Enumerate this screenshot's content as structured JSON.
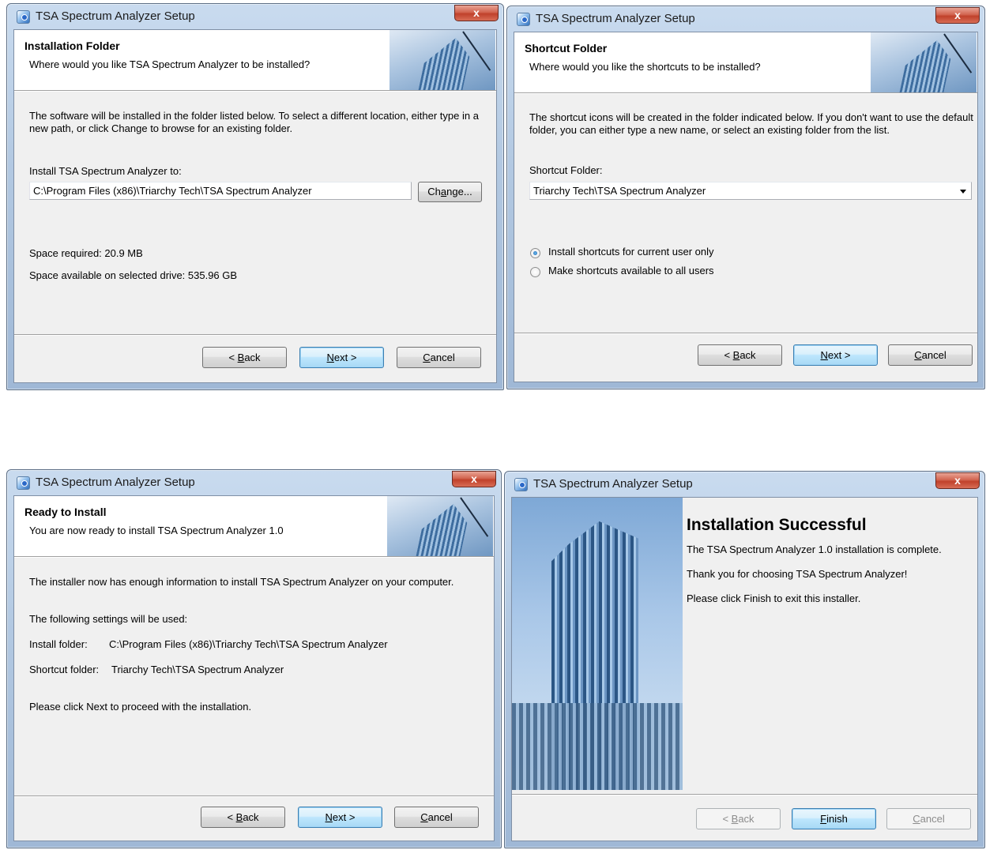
{
  "window_title": "TSA Spectrum Analyzer Setup",
  "close_label": "x",
  "buttons": {
    "back_pre": "< ",
    "back_key": "B",
    "back_post": "ack",
    "next_key": "N",
    "next_post": "ext >",
    "cancel_key": "C",
    "cancel_post": "ancel",
    "finish_key": "F",
    "finish_post": "inish"
  },
  "install_folder": {
    "heading": "Installation Folder",
    "subheading": "Where would you like TSA Spectrum Analyzer to be installed?",
    "description_line1": "The software will be installed in the folder listed below. To select a different location, either type in a",
    "description_line2": "new path, or click Change to browse for an existing folder.",
    "field_label": "Install TSA Spectrum Analyzer to:",
    "path_value": "C:\\Program Files (x86)\\Triarchy Tech\\TSA Spectrum Analyzer",
    "change_pre": "Ch",
    "change_key": "a",
    "change_post": "nge...",
    "space_required": "Space required: 20.9 MB",
    "space_available": "Space available on selected drive: 535.96 GB"
  },
  "shortcut_folder": {
    "heading": "Shortcut Folder",
    "subheading": "Where would you like the shortcuts to be installed?",
    "description_line1": "The shortcut icons will be created in the folder indicated below. If you don't want to use the default",
    "description_line2": "folder, you can either type a new name, or select an existing folder from the list.",
    "field_label": "Shortcut Folder:",
    "selected_value": "Triarchy Tech\\TSA Spectrum Analyzer",
    "radio_current_user": "Install shortcuts for current user only",
    "radio_all_users": "Make shortcuts available to all users"
  },
  "ready": {
    "heading": "Ready to Install",
    "subheading": "You are now ready to install TSA Spectrum Analyzer 1.0",
    "info": "The installer now has enough information to install TSA Spectrum Analyzer on your computer.",
    "settings_intro": "The following settings will be used:",
    "install_folder_label": "Install folder:",
    "install_folder_value": "C:\\Program Files (x86)\\Triarchy Tech\\TSA Spectrum Analyzer",
    "shortcut_folder_label": "Shortcut folder:",
    "shortcut_folder_value": "Triarchy Tech\\TSA Spectrum Analyzer",
    "proceed": "Please click Next to proceed with the installation."
  },
  "success": {
    "heading": "Installation Successful",
    "line1": "The TSA Spectrum Analyzer 1.0 installation is complete.",
    "line2": "Thank you for choosing TSA Spectrum Analyzer!",
    "line3": "Please click Finish to exit this installer."
  }
}
